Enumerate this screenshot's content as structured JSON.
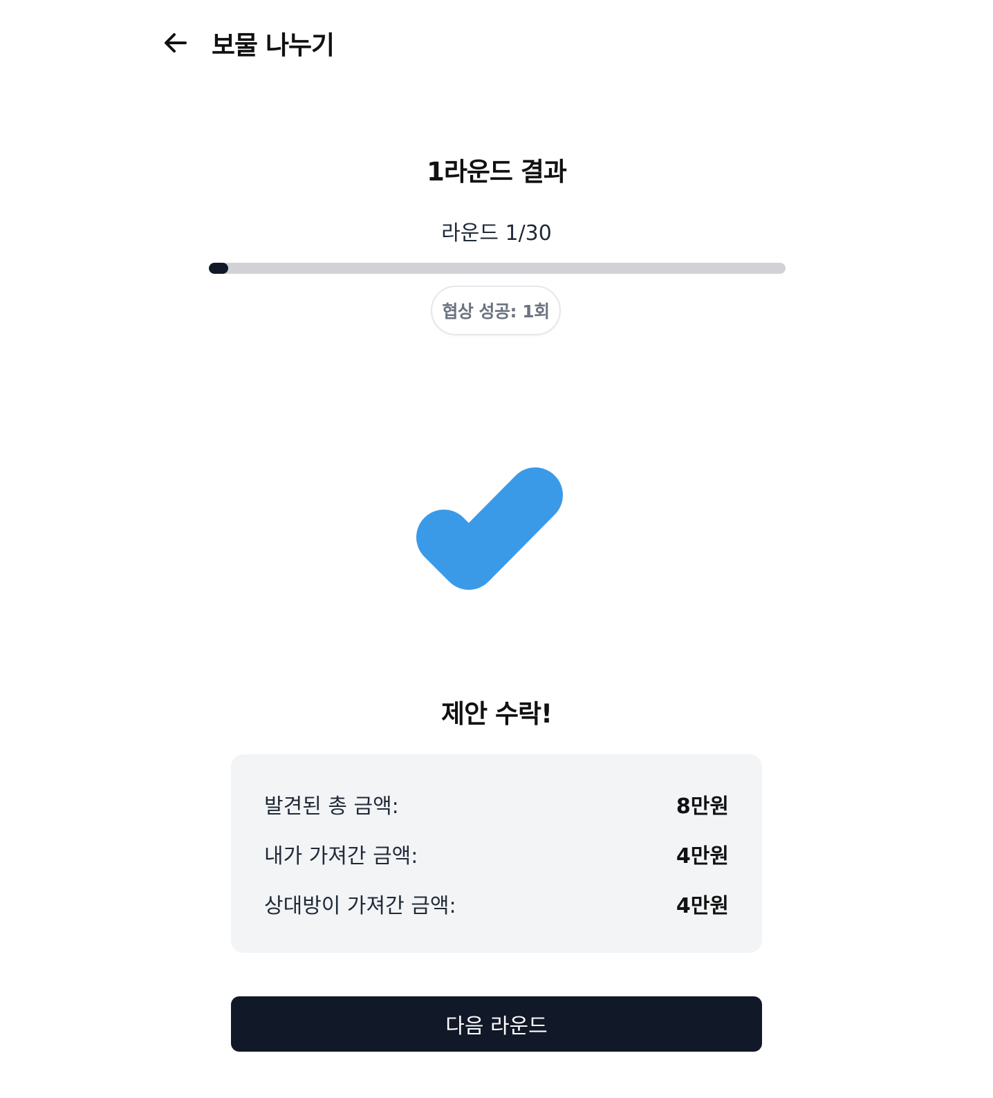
{
  "header": {
    "back_icon": "arrow-left-icon",
    "title": "보물 나누기"
  },
  "round": {
    "title": "1라운드 결과",
    "counter": "라운드 1/30",
    "progress_fraction": 0.0333
  },
  "badge": {
    "text": "협상 성공: 1회"
  },
  "result": {
    "icon": "check-icon",
    "icon_color": "#3b9ae8",
    "title": "제안 수락!"
  },
  "summary": {
    "rows": [
      {
        "label": "발견된 총 금액:",
        "value": "8만원"
      },
      {
        "label": "내가 가져간 금액:",
        "value": "4만원"
      },
      {
        "label": "상대방이 가져간 금액:",
        "value": "4만원"
      }
    ]
  },
  "actions": {
    "next_label": "다음 라운드"
  },
  "colors": {
    "primary": "#111827",
    "card_bg": "#f3f4f6",
    "track": "#d1d1d6",
    "accent": "#3b9ae8"
  }
}
